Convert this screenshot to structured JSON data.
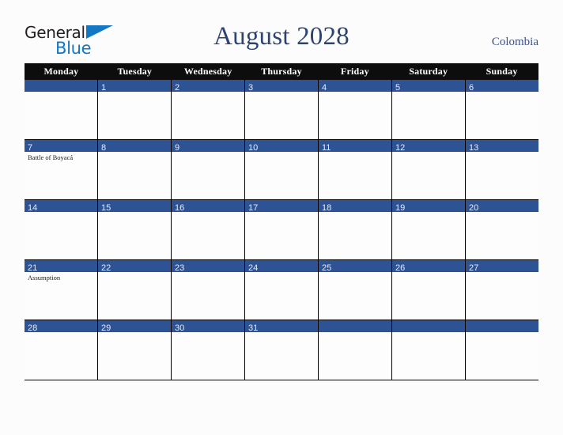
{
  "brand": {
    "name_part1": "General",
    "name_part2": "Blue",
    "triangle_icon": "triangle-icon",
    "accent_color": "#1277c4",
    "text_color": "#231f20"
  },
  "header": {
    "title": "August 2028",
    "country": "Colombia",
    "title_color": "#2d4372",
    "country_color": "#3c5286"
  },
  "calendar": {
    "weekdays": [
      "Monday",
      "Tuesday",
      "Wednesday",
      "Thursday",
      "Friday",
      "Saturday",
      "Sunday"
    ],
    "header_bg": "#0d0d0d",
    "date_band_color": "#2e5395",
    "cell_bg": "#fdfdfe",
    "weeks": [
      [
        {
          "day": "",
          "event": ""
        },
        {
          "day": "1",
          "event": ""
        },
        {
          "day": "2",
          "event": ""
        },
        {
          "day": "3",
          "event": ""
        },
        {
          "day": "4",
          "event": ""
        },
        {
          "day": "5",
          "event": ""
        },
        {
          "day": "6",
          "event": ""
        }
      ],
      [
        {
          "day": "7",
          "event": "Battle of Boyacá"
        },
        {
          "day": "8",
          "event": ""
        },
        {
          "day": "9",
          "event": ""
        },
        {
          "day": "10",
          "event": ""
        },
        {
          "day": "11",
          "event": ""
        },
        {
          "day": "12",
          "event": ""
        },
        {
          "day": "13",
          "event": ""
        }
      ],
      [
        {
          "day": "14",
          "event": ""
        },
        {
          "day": "15",
          "event": ""
        },
        {
          "day": "16",
          "event": ""
        },
        {
          "day": "17",
          "event": ""
        },
        {
          "day": "18",
          "event": ""
        },
        {
          "day": "19",
          "event": ""
        },
        {
          "day": "20",
          "event": ""
        }
      ],
      [
        {
          "day": "21",
          "event": "Assumption"
        },
        {
          "day": "22",
          "event": ""
        },
        {
          "day": "23",
          "event": ""
        },
        {
          "day": "24",
          "event": ""
        },
        {
          "day": "25",
          "event": ""
        },
        {
          "day": "26",
          "event": ""
        },
        {
          "day": "27",
          "event": ""
        }
      ],
      [
        {
          "day": "28",
          "event": ""
        },
        {
          "day": "29",
          "event": ""
        },
        {
          "day": "30",
          "event": ""
        },
        {
          "day": "31",
          "event": ""
        },
        {
          "day": "",
          "event": ""
        },
        {
          "day": "",
          "event": ""
        },
        {
          "day": "",
          "event": ""
        }
      ]
    ]
  }
}
